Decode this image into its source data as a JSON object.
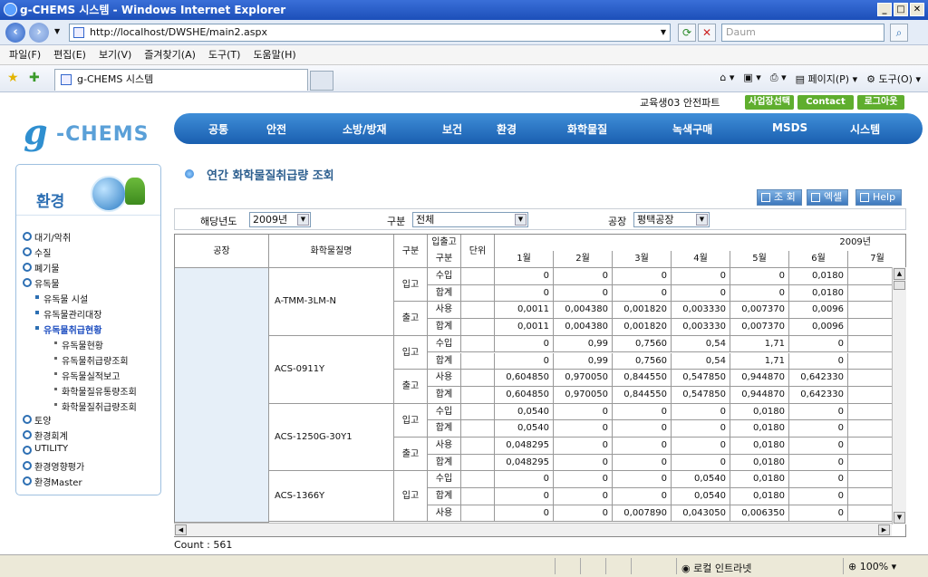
{
  "browser": {
    "title": "g-CHEMS 시스템 - Windows Internet Explorer",
    "url": "http://localhost/DWSHE/main2.aspx",
    "search_placeholder": "Daum",
    "menu": [
      "파일(F)",
      "편집(E)",
      "보기(V)",
      "즐겨찾기(A)",
      "도구(T)",
      "도움말(H)"
    ],
    "tab_title": "g-CHEMS 시스템",
    "cmd_page": "페이지(P)",
    "cmd_tools": "도구(O)",
    "status_zone": "로컬 인트라넷",
    "status_zoom": "100%"
  },
  "header": {
    "user_info": "교육생03 안전파트",
    "btn_site": "사업장선택",
    "btn_contact": "Contact Us",
    "btn_logout": "로그아웃",
    "logo_g": "g",
    "logo_text": "-CHEMS",
    "nav": [
      "공통",
      "안전",
      "소방/방재",
      "보건",
      "환경",
      "화학물질",
      "녹색구매",
      "MSDS",
      "시스템"
    ]
  },
  "sidebar": {
    "title": "환경",
    "items": [
      {
        "label": "대기/악취",
        "level": 1
      },
      {
        "label": "수질",
        "level": 1
      },
      {
        "label": "폐기물",
        "level": 1
      },
      {
        "label": "유독물",
        "level": 1
      },
      {
        "label": "유독물 시설",
        "level": 2
      },
      {
        "label": "유독물관리대장",
        "level": 2
      },
      {
        "label": "유독물취급현황",
        "level": 2,
        "active": true
      },
      {
        "label": "유독물현황",
        "level": 3
      },
      {
        "label": "유독물취급량조회",
        "level": 3
      },
      {
        "label": "유독물실적보고",
        "level": 3
      },
      {
        "label": "화학물질유통량조회",
        "level": 3
      },
      {
        "label": "화학물질취급량조회",
        "level": 3
      },
      {
        "label": "토양",
        "level": 1
      },
      {
        "label": "환경회계",
        "level": 1
      },
      {
        "label": "UTILITY",
        "level": 1
      },
      {
        "label": "환경영향평가",
        "level": 1
      },
      {
        "label": "환경Master",
        "level": 1
      }
    ]
  },
  "page": {
    "title": "연간 화학물질취급량 조회",
    "btn_search": "조 회",
    "btn_excel": "엑셀",
    "btn_help": "Help",
    "filter_year_label": "해당년도",
    "filter_year_value": "2009년",
    "filter_type_label": "구분",
    "filter_type_value": "전체",
    "filter_plant_label": "공장",
    "filter_plant_value": "평택공장",
    "count_text": "Count : 561"
  },
  "grid": {
    "headers": {
      "plant": "공장",
      "chem": "화학물질명",
      "type": "구분",
      "inout_1": "입출고",
      "inout_2": "구분",
      "unit": "단위",
      "year": "2009년",
      "months": [
        "1월",
        "2월",
        "3월",
        "4월",
        "5월",
        "6월",
        "7월"
      ]
    },
    "groups": [
      {
        "chem": "A-TMM-3LM-N",
        "blocks": [
          {
            "type": "입고",
            "rows": [
              {
                "sub": "수입",
                "vals": [
                  "0",
                  "0",
                  "0",
                  "0",
                  "0",
                  "0,0180"
                ]
              },
              {
                "sub": "합계",
                "vals": [
                  "0",
                  "0",
                  "0",
                  "0",
                  "0",
                  "0,0180"
                ]
              }
            ]
          },
          {
            "type": "출고",
            "rows": [
              {
                "sub": "사용",
                "vals": [
                  "0,0011",
                  "0,004380",
                  "0,001820",
                  "0,003330",
                  "0,007370",
                  "0,0096"
                ]
              },
              {
                "sub": "합계",
                "vals": [
                  "0,0011",
                  "0,004380",
                  "0,001820",
                  "0,003330",
                  "0,007370",
                  "0,0096"
                ]
              }
            ]
          }
        ]
      },
      {
        "chem": "ACS-0911Y",
        "blocks": [
          {
            "type": "입고",
            "rows": [
              {
                "sub": "수입",
                "vals": [
                  "0",
                  "0,99",
                  "0,7560",
                  "0,54",
                  "1,71",
                  "0"
                ]
              },
              {
                "sub": "합계",
                "vals": [
                  "0",
                  "0,99",
                  "0,7560",
                  "0,54",
                  "1,71",
                  "0"
                ]
              }
            ]
          },
          {
            "type": "출고",
            "rows": [
              {
                "sub": "사용",
                "vals": [
                  "0,604850",
                  "0,970050",
                  "0,844550",
                  "0,547850",
                  "0,944870",
                  "0,642330"
                ]
              },
              {
                "sub": "합계",
                "vals": [
                  "0,604850",
                  "0,970050",
                  "0,844550",
                  "0,547850",
                  "0,944870",
                  "0,642330"
                ]
              }
            ]
          }
        ]
      },
      {
        "chem": "ACS-1250G-30Y1",
        "blocks": [
          {
            "type": "입고",
            "rows": [
              {
                "sub": "수입",
                "vals": [
                  "0,0540",
                  "0",
                  "0",
                  "0",
                  "0,0180",
                  "0"
                ]
              },
              {
                "sub": "합계",
                "vals": [
                  "0,0540",
                  "0",
                  "0",
                  "0",
                  "0,0180",
                  "0"
                ]
              }
            ]
          },
          {
            "type": "출고",
            "rows": [
              {
                "sub": "사용",
                "vals": [
                  "0,048295",
                  "0",
                  "0",
                  "0",
                  "0,0180",
                  "0"
                ]
              },
              {
                "sub": "합계",
                "vals": [
                  "0,048295",
                  "0",
                  "0",
                  "0",
                  "0,0180",
                  "0"
                ]
              }
            ]
          }
        ]
      },
      {
        "chem": "ACS-1366Y",
        "blocks": [
          {
            "type": "입고",
            "rows": [
              {
                "sub": "수입",
                "vals": [
                  "0",
                  "0",
                  "0",
                  "0,0540",
                  "0,0180",
                  "0"
                ]
              },
              {
                "sub": "합계",
                "vals": [
                  "0",
                  "0",
                  "0",
                  "0,0540",
                  "0,0180",
                  "0"
                ]
              },
              {
                "sub": "사용",
                "vals": [
                  "0",
                  "0",
                  "0,007890",
                  "0,043050",
                  "0,006350",
                  "0"
                ]
              }
            ]
          }
        ]
      }
    ]
  }
}
